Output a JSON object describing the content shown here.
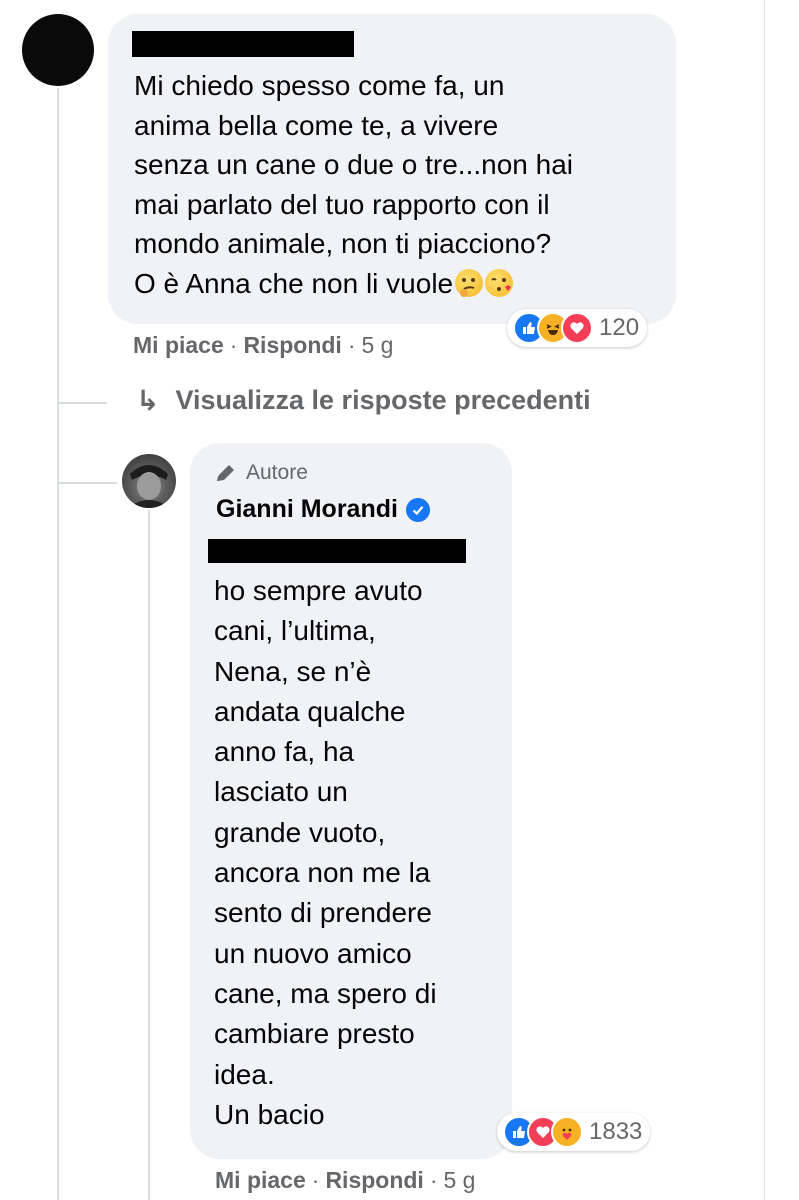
{
  "comment1": {
    "author_hidden": "",
    "text": "Mi chiedo spesso come fa, un\nanima bella come te, a vivere\nsenza un cane o due o tre...non hai\nmai parlato del tuo rapporto con il\nmondo animale, non ti piacciono?\nO è Anna che non li vuole",
    "emojis": [
      "thinking-face-emoji",
      "face-blowing-kiss-emoji"
    ],
    "reactions": {
      "icons": [
        "like-reaction-icon",
        "haha-reaction-icon",
        "care-reaction-icon"
      ],
      "count": "120"
    },
    "actions": {
      "like": "Mi piace",
      "reply": "Rispondi",
      "time": "5 g"
    }
  },
  "view_previous": {
    "arrow": "↳",
    "label": "Visualizza le risposte precedenti"
  },
  "reply": {
    "badge": "Autore",
    "author": "Gianni Morandi",
    "text": "ho sempre avuto\ncani, l’ultima,\nNena, se n’è\nandata qualche\nanno fa, ha\nlasciato un\ngrande vuoto,\nancora non me la\nsento di prendere\nun nuovo amico\ncane, ma spero di\ncambiare presto\nidea.\nUn bacio",
    "reactions": {
      "icons": [
        "like-reaction-icon",
        "love-reaction-icon",
        "care-reaction-icon"
      ],
      "count": "1833"
    },
    "actions": {
      "like": "Mi piace",
      "reply": "Rispondi",
      "time": "5 g"
    }
  },
  "separator": "·",
  "colors": {
    "bubble": "#f0f2f5",
    "meta": "#65676b",
    "like": "#1877f2",
    "love": "#f33e58",
    "haha": "#f7b125"
  }
}
